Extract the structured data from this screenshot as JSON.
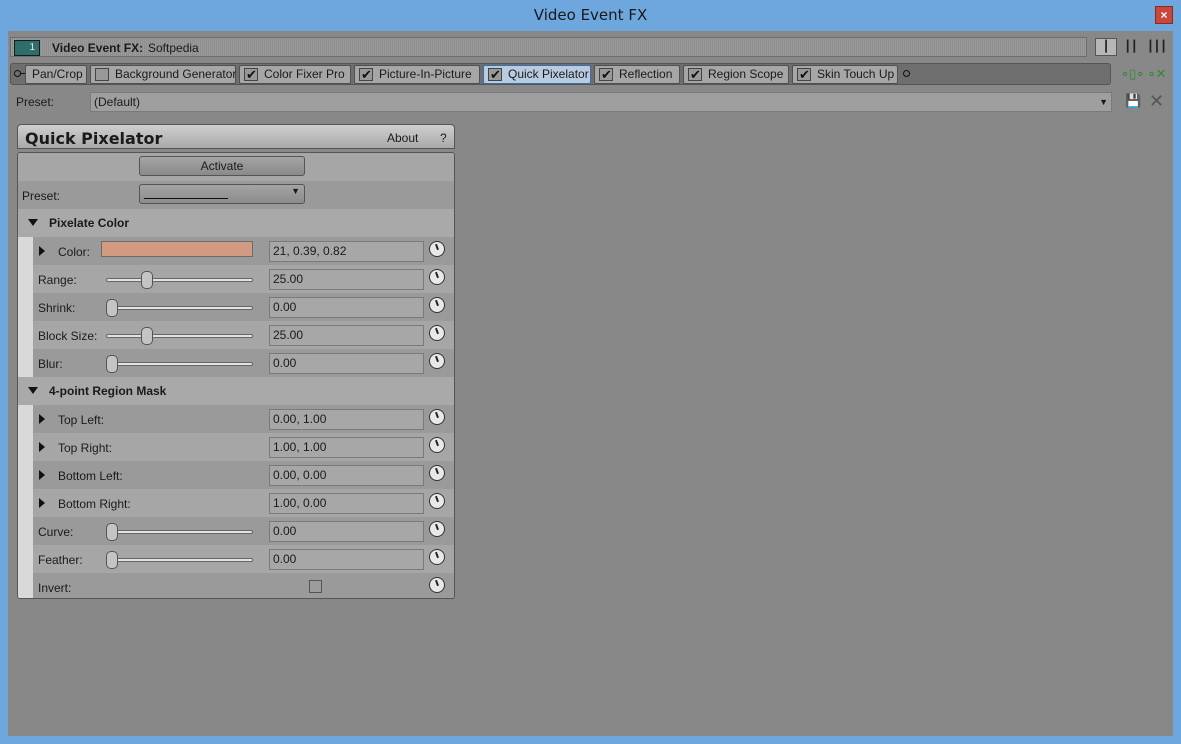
{
  "window": {
    "title": "Video Event FX",
    "close": "×"
  },
  "header": {
    "icon_text": "1",
    "label": "Video Event FX:",
    "value": "Softpedia"
  },
  "chain": [
    {
      "label": "Pan/Crop",
      "checkbox": "none"
    },
    {
      "label": "Background Generator",
      "checkbox": "unchecked"
    },
    {
      "label": "Color Fixer Pro",
      "checkbox": "checked"
    },
    {
      "label": "Picture-In-Picture",
      "checkbox": "checked"
    },
    {
      "label": "Quick Pixelator",
      "checkbox": "checked",
      "selected": true
    },
    {
      "label": "Reflection",
      "checkbox": "checked"
    },
    {
      "label": "Region Scope",
      "checkbox": "checked"
    },
    {
      "label": "Skin Touch Up",
      "checkbox": "checked"
    }
  ],
  "preset": {
    "label": "Preset:",
    "value": "(Default)"
  },
  "plugin": {
    "title": "Quick Pixelator",
    "about": "About",
    "help": "?",
    "activate": "Activate",
    "preset_label": "Preset:",
    "sections": [
      {
        "title": "Pixelate Color",
        "params": [
          {
            "label": "Color:",
            "type": "color",
            "value": "21, 0.39, 0.82",
            "swatch": "#d29a81",
            "expandable": true
          },
          {
            "label": "Range:",
            "type": "slider",
            "value": "25.00",
            "level": 0.25
          },
          {
            "label": "Shrink:",
            "type": "slider",
            "value": "0.00",
            "level": 0.0
          },
          {
            "label": "Block Size:",
            "type": "slider",
            "value": "25.00",
            "level": 0.25
          },
          {
            "label": "Blur:",
            "type": "slider",
            "value": "0.00",
            "level": 0.0
          }
        ]
      },
      {
        "title": "4-point Region Mask",
        "params": [
          {
            "label": "Top Left:",
            "type": "point",
            "value": "0.00, 1.00",
            "expandable": true
          },
          {
            "label": "Top Right:",
            "type": "point",
            "value": "1.00, 1.00",
            "expandable": true
          },
          {
            "label": "Bottom Left:",
            "type": "point",
            "value": "0.00, 0.00",
            "expandable": true
          },
          {
            "label": "Bottom Right:",
            "type": "point",
            "value": "1.00, 0.00",
            "expandable": true
          },
          {
            "label": "Curve:",
            "type": "slider",
            "value": "0.00",
            "level": 0.0
          },
          {
            "label": "Feather:",
            "type": "slider",
            "value": "0.00",
            "level": 0.0
          },
          {
            "label": "Invert:",
            "type": "checkbox",
            "value": ""
          }
        ]
      }
    ]
  }
}
